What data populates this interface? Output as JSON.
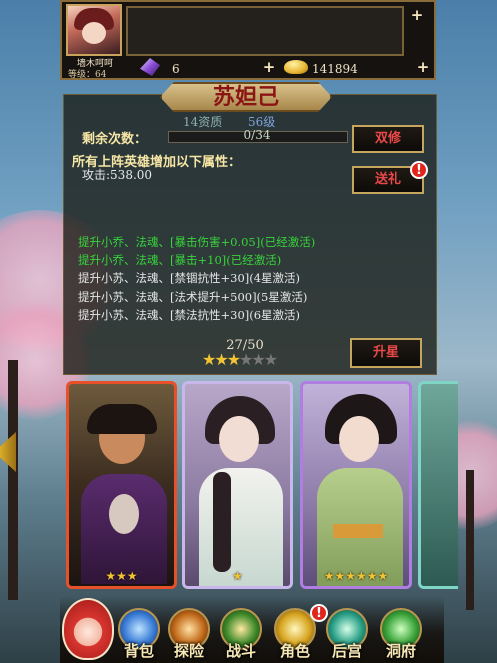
{
  "player": {
    "name": "墙木呵呵",
    "level_text": "等级：64",
    "gems": "6",
    "gold": "141894"
  },
  "hero": {
    "name": "苏妲己",
    "aptitude": "14资质",
    "level": "56级",
    "remaining_label": "剩余次数：",
    "remaining_value": "0/34",
    "buff_title": "所有上阵英雄增加以下属性：",
    "attack_text": "攻击:538.00",
    "buffs": [
      {
        "text": "提升小乔、法魂、[暴击伤害+0.05](已经激活)",
        "active": true
      },
      {
        "text": "提升小乔、法魂、[暴击+10](已经激活)",
        "active": true
      },
      {
        "text": "提升小苏、法魂、[禁锢抗性+30](4星激活)",
        "active": false
      },
      {
        "text": "提升小苏、法魂、[法术提升+500](5星激活)",
        "active": false
      },
      {
        "text": "提升小苏、法魂、[禁法抗性+30](6星激活)",
        "active": false
      }
    ],
    "star_progress": "27/50",
    "stars_filled": 3,
    "stars_total": 6
  },
  "buttons": {
    "dual_cultivate": "双修",
    "gift": "送礼",
    "upgrade_star": "升星"
  },
  "cards": [
    {
      "stars": "★★★",
      "frame_color": "#e8502a"
    },
    {
      "stars": "★",
      "frame_color": "#c9b6ea"
    },
    {
      "stars": "★★★★★★",
      "frame_color": "#b07ee0"
    }
  ],
  "nav": {
    "bag": "背包",
    "explore": "探险",
    "battle": "战斗",
    "role": "角色",
    "harem": "后宫",
    "cave": "洞府"
  },
  "colors": {
    "active_text": "#37d43b",
    "title_text": "#f6e6a5",
    "hero_name": "#8b1414",
    "alert_badge": "#e0261c"
  }
}
